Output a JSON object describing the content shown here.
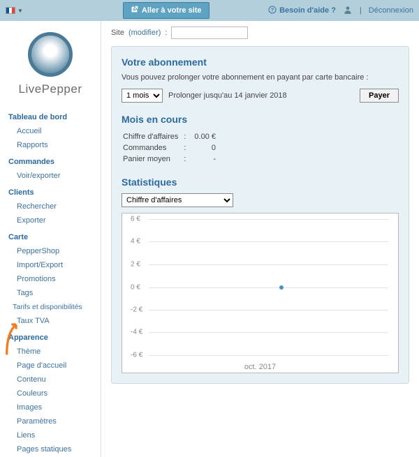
{
  "topbar": {
    "site_button": "Aller à votre site",
    "help": "Besoin d'aide ?",
    "logout": "Déconnexion",
    "language": "fr"
  },
  "logo": {
    "text": "LivePepper"
  },
  "sidebar": {
    "sections": [
      {
        "title": "Tableau de bord",
        "items": [
          "Accueil",
          "Rapports"
        ]
      },
      {
        "title": "Commandes",
        "items": [
          "Voir/exporter"
        ]
      },
      {
        "title": "Clients",
        "items": [
          "Rechercher",
          "Exporter"
        ]
      },
      {
        "title": "Carte",
        "items": [
          "PepperShop",
          "Import/Export",
          "Promotions",
          "Tags",
          "Tarifs et disponibilités",
          "Taux TVA"
        ]
      },
      {
        "title": "Apparence",
        "items": [
          "Thème",
          "Page d'accueil",
          "Contenu",
          "Couleurs",
          "Images",
          "Paramètres",
          "Liens",
          "Pages statiques"
        ]
      }
    ]
  },
  "content": {
    "site_label": "Site",
    "modify_link": "(modifier)",
    "colon": ":",
    "subscription": {
      "heading": "Votre abonnement",
      "desc": "Vous pouvez prolonger votre abonnement en payant par carte bancaire :",
      "duration": "1 mois",
      "prolong": "Prolonger jusqu'au 14 janvier 2018",
      "pay": "Payer"
    },
    "current_month": {
      "heading": "Mois en cours",
      "rows": [
        {
          "label": "Chiffre d'affaires",
          "value": "0.00 €"
        },
        {
          "label": "Commandes",
          "value": "0"
        },
        {
          "label": "Panier moyen",
          "value": "-"
        }
      ]
    },
    "stats": {
      "heading": "Statistiques",
      "metric": "Chiffre d'affaires"
    }
  },
  "chart_data": {
    "type": "line",
    "title": "",
    "xlabel": "",
    "ylabel": "",
    "ylim": [
      -6,
      6
    ],
    "yticks": [
      "6 €",
      "4 €",
      "2 €",
      "0 €",
      "-2 €",
      "-4 €",
      "-6 €"
    ],
    "categories": [
      "oct. 2017"
    ],
    "series": [
      {
        "name": "Chiffre d'affaires",
        "values": [
          0
        ]
      }
    ]
  }
}
